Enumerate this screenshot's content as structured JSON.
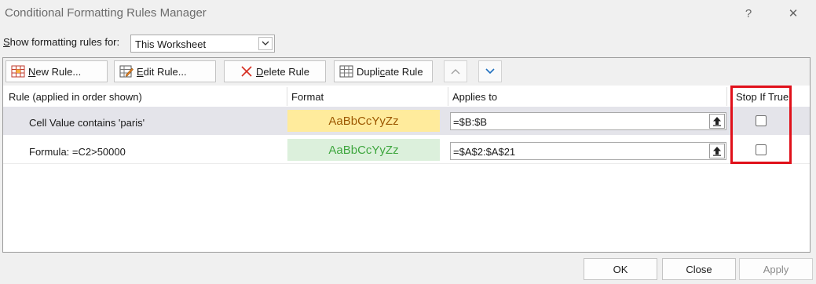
{
  "window": {
    "title": "Conditional Formatting Rules Manager",
    "help_glyph": "?",
    "close_glyph": "✕"
  },
  "show_rules": {
    "label_pre": "S",
    "label_rest": "how formatting rules for:",
    "selected": "This Worksheet"
  },
  "toolbar": {
    "new_rule": {
      "pre": "",
      "acc": "N",
      "post": "ew Rule..."
    },
    "edit_rule": {
      "pre": "",
      "acc": "E",
      "post": "dit Rule..."
    },
    "delete_rule": {
      "pre": "",
      "acc": "D",
      "post": "elete Rule"
    },
    "duplicate_rule": {
      "pre": "Dupli",
      "acc": "c",
      "post": "ate Rule"
    }
  },
  "columns": {
    "rule": "Rule (applied in order shown)",
    "format": "Format",
    "applies_to": "Applies to",
    "stop_if_true": "Stop If True"
  },
  "rules": [
    {
      "rule": "Cell Value contains 'paris'",
      "preview": "AaBbCcYyZz",
      "applies_to": "=$B:$B",
      "stop_if_true": false,
      "fill": "#ffeb9c",
      "font_color": "#9c5700"
    },
    {
      "rule": "Formula: =C2>50000",
      "preview": "AaBbCcYyZz",
      "applies_to": "=$A$2:$A$21",
      "stop_if_true": false,
      "fill": "#dcf0dc",
      "font_color": "#3ea63e"
    }
  ],
  "footer": {
    "ok": "OK",
    "close": "Close",
    "apply": "Apply"
  },
  "colors": {
    "highlight_box": "#e0101a"
  }
}
